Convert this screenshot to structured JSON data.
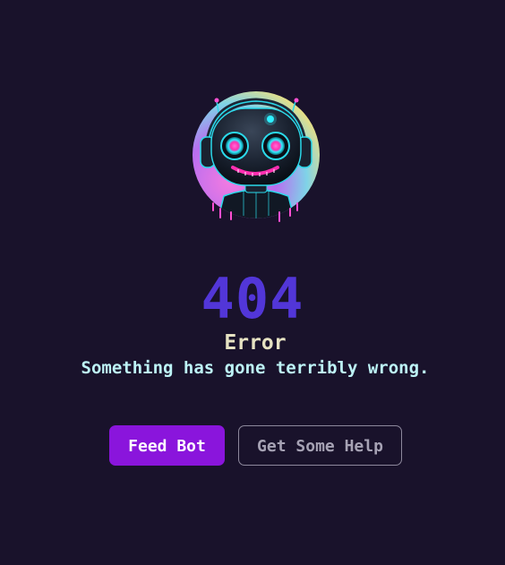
{
  "error": {
    "code": "404",
    "title": "Error",
    "message": "Something has gone terribly wrong."
  },
  "avatar": {
    "icon": "robot-headphones-icon"
  },
  "actions": {
    "primary_label": "Feed Bot",
    "secondary_label": "Get Some Help"
  },
  "colors": {
    "background": "#19122b",
    "code": "#5236d8",
    "title": "#e6e2c2",
    "message": "#bdf3f6",
    "primary_button": "#8a15dc",
    "secondary_border": "#8d889c"
  }
}
